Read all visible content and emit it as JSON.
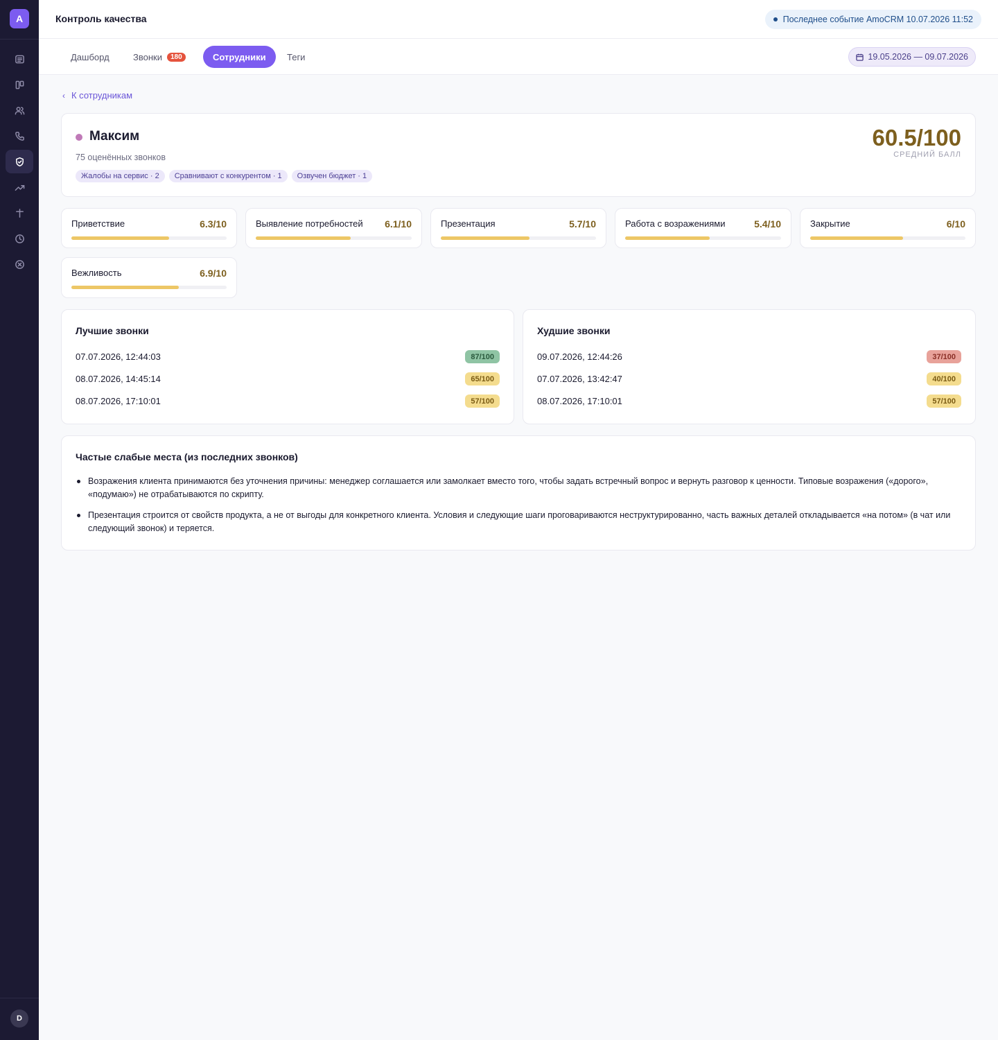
{
  "app": {
    "logo_letter": "A",
    "user_initial": "D"
  },
  "header": {
    "title": "Контроль качества",
    "event": "Последнее событие AmoCRM 10.07.2026 11:52"
  },
  "tabs": [
    {
      "label": "Дашборд"
    },
    {
      "label": "Звонки",
      "badge": "180"
    },
    {
      "label": "Сотрудники",
      "active": true
    },
    {
      "label": "Теги"
    }
  ],
  "date_range": "19.05.2026 — 09.07.2026",
  "back_link": "К сотрудникам",
  "employee": {
    "name": "Максим",
    "rated_calls": "75 оценённых звонков",
    "tags": [
      "Жалобы на сервис · 2",
      "Сравнивают с конкурентом · 1",
      "Озвучен бюджет · 1"
    ],
    "avg_score": "60.5/100",
    "avg_label": "СРЕДНИЙ БАЛЛ"
  },
  "criteria": [
    {
      "name": "Приветствие",
      "value": "6.3/10",
      "fraction": 0.63
    },
    {
      "name": "Выявление потребностей",
      "value": "6.1/10",
      "fraction": 0.61
    },
    {
      "name": "Презентация",
      "value": "5.7/10",
      "fraction": 0.57
    },
    {
      "name": "Работа с возражениями",
      "value": "5.4/10",
      "fraction": 0.54
    },
    {
      "name": "Закрытие",
      "value": "6/10",
      "fraction": 0.6
    },
    {
      "name": "Вежливость",
      "value": "6.9/10",
      "fraction": 0.69
    }
  ],
  "best_calls": {
    "title": "Лучшие звонки",
    "rows": [
      {
        "date": "07.07.2026, 12:44:03",
        "score": "87/100",
        "level": "good"
      },
      {
        "date": "08.07.2026, 14:45:14",
        "score": "65/100",
        "level": "mid"
      },
      {
        "date": "08.07.2026, 17:10:01",
        "score": "57/100",
        "level": "mid"
      }
    ]
  },
  "worst_calls": {
    "title": "Худшие звонки",
    "rows": [
      {
        "date": "09.07.2026, 12:44:26",
        "score": "37/100",
        "level": "bad"
      },
      {
        "date": "07.07.2026, 13:42:47",
        "score": "40/100",
        "level": "mid"
      },
      {
        "date": "08.07.2026, 17:10:01",
        "score": "57/100",
        "level": "mid"
      }
    ]
  },
  "weak_points": {
    "title": "Частые слабые места (из последних звонков)",
    "items": [
      "Возражения клиента принимаются без уточнения причины: менеджер соглашается или замолкает вместо того, чтобы задать встречный вопрос и вернуть разговор к ценности. Типовые возражения («дорого», «подумаю») не отрабатываются по скрипту.",
      "Презентация строится от свойств продукта, а не от выгоды для конкретного клиента. Условия и следующие шаги проговариваются неструктурированно, часть важных деталей откладывается «на потом» (в чат или следующий звонок) и теряется."
    ]
  },
  "colors": {
    "accent": "#7c5cf0",
    "sidebar": "#1c1a33",
    "score": "#7d5f1e",
    "bar": "#edc766"
  }
}
